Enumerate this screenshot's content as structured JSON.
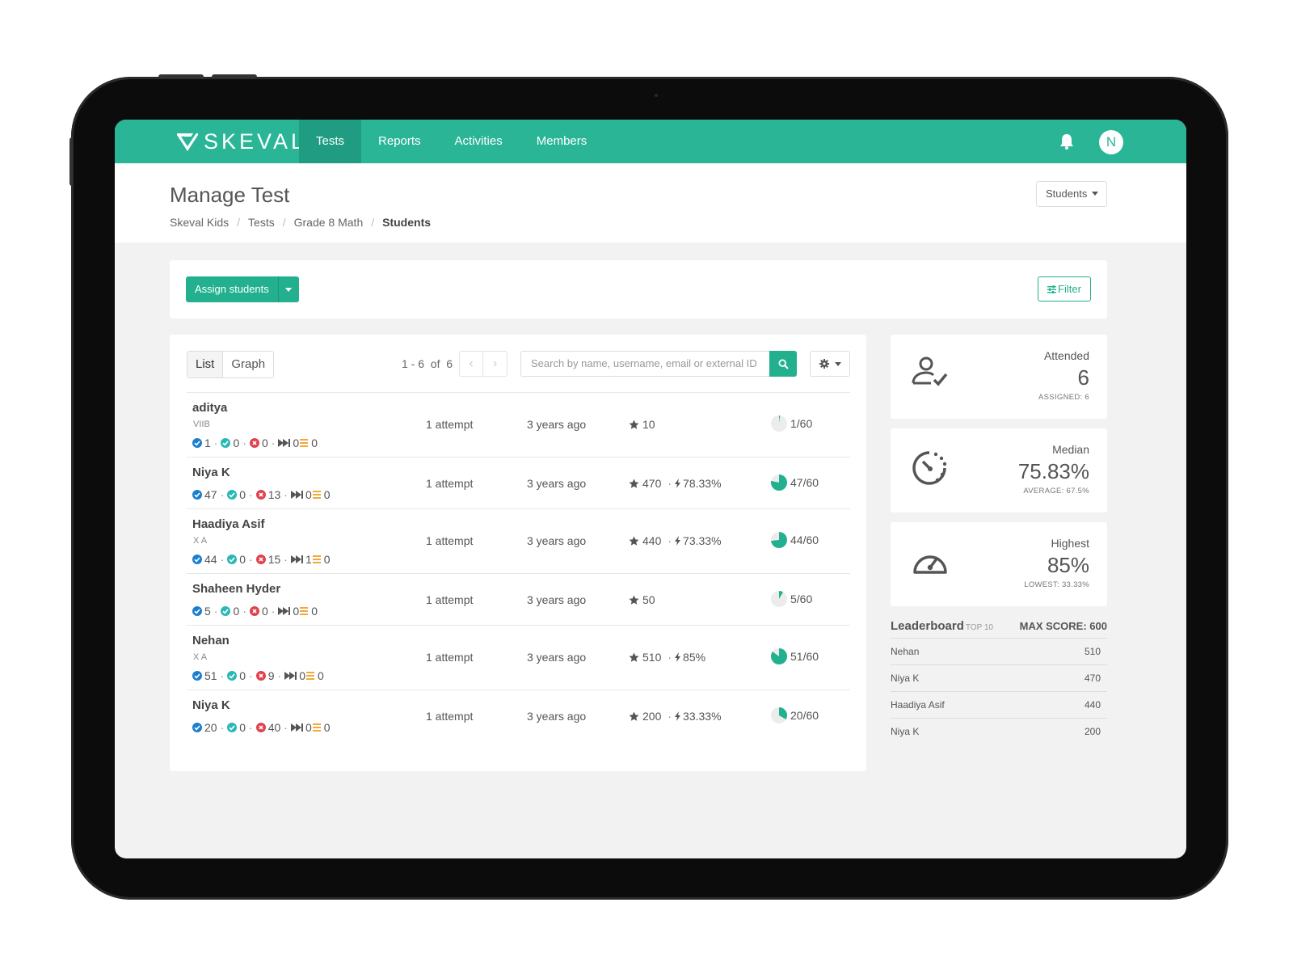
{
  "app": {
    "brand": "SKEVAL",
    "accent": "#2bb597",
    "avatar_initial": "N"
  },
  "nav": {
    "items": [
      {
        "label": "Tests"
      },
      {
        "label": "Reports"
      },
      {
        "label": "Activities"
      },
      {
        "label": "Members"
      }
    ],
    "active": "Tests"
  },
  "header": {
    "title": "Manage Test",
    "breadcrumb": [
      "Skeval Kids",
      "Tests",
      "Grade 8 Math",
      "Students"
    ],
    "view_select": "Students"
  },
  "toolbar": {
    "assign_label": "Assign students",
    "filter_label": "Filter"
  },
  "list": {
    "view_tabs": [
      "List",
      "Graph"
    ],
    "selected_view": "List",
    "pager_text": "1 - 6  of  6",
    "search_placeholder": "Search by name, username, email or external ID",
    "rows": [
      {
        "name": "aditya",
        "section": "VIIB",
        "correct": "1",
        "partial": "0",
        "wrong": "0",
        "skipped": "0",
        "unattempted": "0",
        "attempts": "1 attempt",
        "when": "3 years ago",
        "points": "10",
        "accuracy": "",
        "fraction": "1/60",
        "progress": 0.0167
      },
      {
        "name": "Niya K",
        "section": "",
        "correct": "47",
        "partial": "0",
        "wrong": "13",
        "skipped": "0",
        "unattempted": "0",
        "attempts": "1 attempt",
        "when": "3 years ago",
        "points": "470",
        "accuracy": "78.33%",
        "fraction": "47/60",
        "progress": 0.7833
      },
      {
        "name": "Haadiya Asif",
        "section": "X A",
        "correct": "44",
        "partial": "0",
        "wrong": "15",
        "skipped": "1",
        "unattempted": "0",
        "attempts": "1 attempt",
        "when": "3 years ago",
        "points": "440",
        "accuracy": "73.33%",
        "fraction": "44/60",
        "progress": 0.7333
      },
      {
        "name": "Shaheen Hyder",
        "section": "",
        "correct": "5",
        "partial": "0",
        "wrong": "0",
        "skipped": "0",
        "unattempted": "0",
        "attempts": "1 attempt",
        "when": "3 years ago",
        "points": "50",
        "accuracy": "",
        "fraction": "5/60",
        "progress": 0.0833
      },
      {
        "name": "Nehan",
        "section": "X A",
        "correct": "51",
        "partial": "0",
        "wrong": "9",
        "skipped": "0",
        "unattempted": "0",
        "attempts": "1 attempt",
        "when": "3 years ago",
        "points": "510",
        "accuracy": "85%",
        "fraction": "51/60",
        "progress": 0.85
      },
      {
        "name": "Niya K",
        "section": "",
        "correct": "20",
        "partial": "0",
        "wrong": "40",
        "skipped": "0",
        "unattempted": "0",
        "attempts": "1 attempt",
        "when": "3 years ago",
        "points": "200",
        "accuracy": "33.33%",
        "fraction": "20/60",
        "progress": 0.3333
      }
    ]
  },
  "stats": {
    "attended": {
      "label": "Attended",
      "value": "6",
      "sub": "ASSIGNED: 6"
    },
    "median": {
      "label": "Median",
      "value": "75.83%",
      "sub": "AVERAGE: 67.5%"
    },
    "highest": {
      "label": "Highest",
      "value": "85%",
      "sub": "LOWEST: 33.33%"
    }
  },
  "leaderboard": {
    "title": "Leaderboard",
    "tag": "TOP 10",
    "max_score": "MAX SCORE: 600",
    "rows": [
      {
        "name": "Nehan",
        "score": "510"
      },
      {
        "name": "Niya K",
        "score": "470"
      },
      {
        "name": "Haadiya Asif",
        "score": "440"
      },
      {
        "name": "Niya K",
        "score": "200"
      }
    ]
  },
  "colors": {
    "correct": "#1b7fcf",
    "partial": "#2ab8b5",
    "wrong": "#e0434d",
    "unattempted": "#f2a93b"
  }
}
